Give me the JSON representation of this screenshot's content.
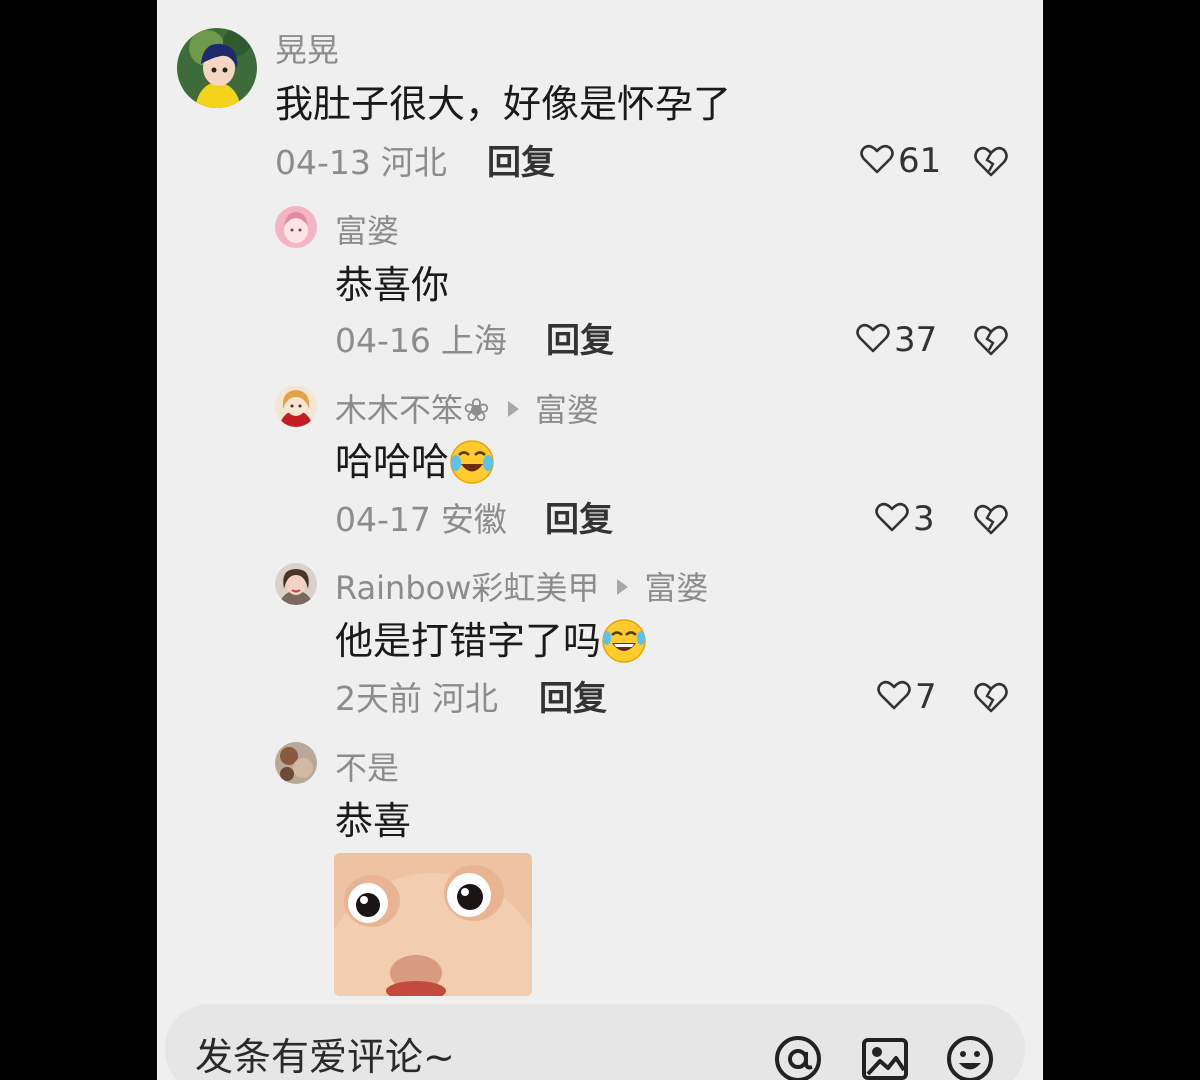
{
  "comments": [
    {
      "user": "晃晃",
      "text": "我肚子很大，好像是怀孕了",
      "date": "04-13",
      "location": "河北",
      "reply_label": "回复",
      "likes": "61"
    },
    {
      "user": "富婆",
      "text": "恭喜你",
      "date": "04-16",
      "location": "上海",
      "reply_label": "回复",
      "likes": "37"
    },
    {
      "user": "木木不笨❀",
      "reply_to": "富婆",
      "text": "哈哈哈",
      "emoji": "laughing-crying-emoji",
      "date": "04-17",
      "location": "安徽",
      "reply_label": "回复",
      "likes": "3"
    },
    {
      "user": "Rainbow彩虹美甲",
      "reply_to": "富婆",
      "text": "他是打错字了吗",
      "emoji": "tears-of-joy-emoji",
      "date": "2天前",
      "location": "河北",
      "reply_label": "回复",
      "likes": "7"
    },
    {
      "user": "不是",
      "text": "恭喜",
      "sticker": "baby-face-sticker"
    }
  ],
  "bottom_bar": {
    "placeholder": "发条有爱评论~",
    "icons": [
      "at-icon",
      "image-icon",
      "emoji-icon"
    ]
  },
  "colors": {
    "background": "#efefef",
    "meta_text": "#8c8c8c",
    "primary_text": "#1a1a1a"
  }
}
